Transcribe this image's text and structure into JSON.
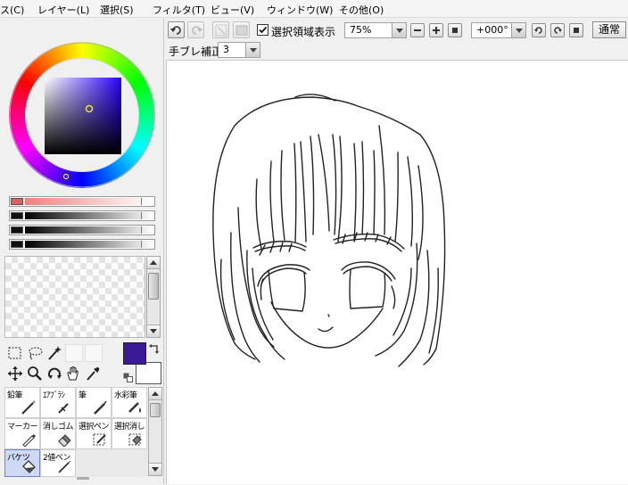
{
  "menu": [
    {
      "label": "ス(C)"
    },
    {
      "label": "レイヤー(L)"
    },
    {
      "label": "選択(S)"
    },
    {
      "label": "フィルタ(T)"
    },
    {
      "label": "ビュー(V)"
    },
    {
      "label": "ウィンドウ(W)"
    },
    {
      "label": "その他(O)"
    }
  ],
  "toolbar": {
    "selection_checkbox_label": "選択領域表示",
    "selection_checked": true,
    "zoom_value": "75%",
    "rotation_value": "+000°",
    "blend_mode": "通常",
    "stabilizer_label": "手ブレ補正",
    "stabilizer_value": "3"
  },
  "colors": {
    "primary": "#3b1a96",
    "secondary": "#ffffff",
    "accent_red": "#e06060",
    "selected_tool_bg": "#cfd8f5"
  },
  "color_panel": {
    "modes": [
      "color-wheel-icon",
      "rgb-slider-icon",
      "hsv-slider-icon",
      "color-set-icon",
      "swatch-icon",
      "scratchpad-icon"
    ]
  },
  "tools": [
    "rect-select-icon",
    "lasso-icon",
    "magic-wand-icon",
    "move-icon",
    "zoom-icon",
    "rotate-icon",
    "hand-icon",
    "eyedropper-icon"
  ],
  "brushes": [
    {
      "label": "鉛筆",
      "icon": "pencil-icon"
    },
    {
      "label": "ｴｱﾌﾞﾗｼ",
      "icon": "airbrush-icon"
    },
    {
      "label": "筆",
      "icon": "brush-icon"
    },
    {
      "label": "水彩筆",
      "icon": "watercolor-icon"
    },
    {
      "label": "マーカー",
      "icon": "marker-icon"
    },
    {
      "label": "消しゴム",
      "icon": "eraser-icon"
    },
    {
      "label": "選択ペン",
      "icon": "select-pen-icon"
    },
    {
      "label": "選択消し",
      "icon": "select-erase-icon"
    },
    {
      "label": "バケツ",
      "icon": "bucket-icon",
      "selected": true
    },
    {
      "label": "2値ペン",
      "icon": "binary-pen-icon"
    }
  ]
}
